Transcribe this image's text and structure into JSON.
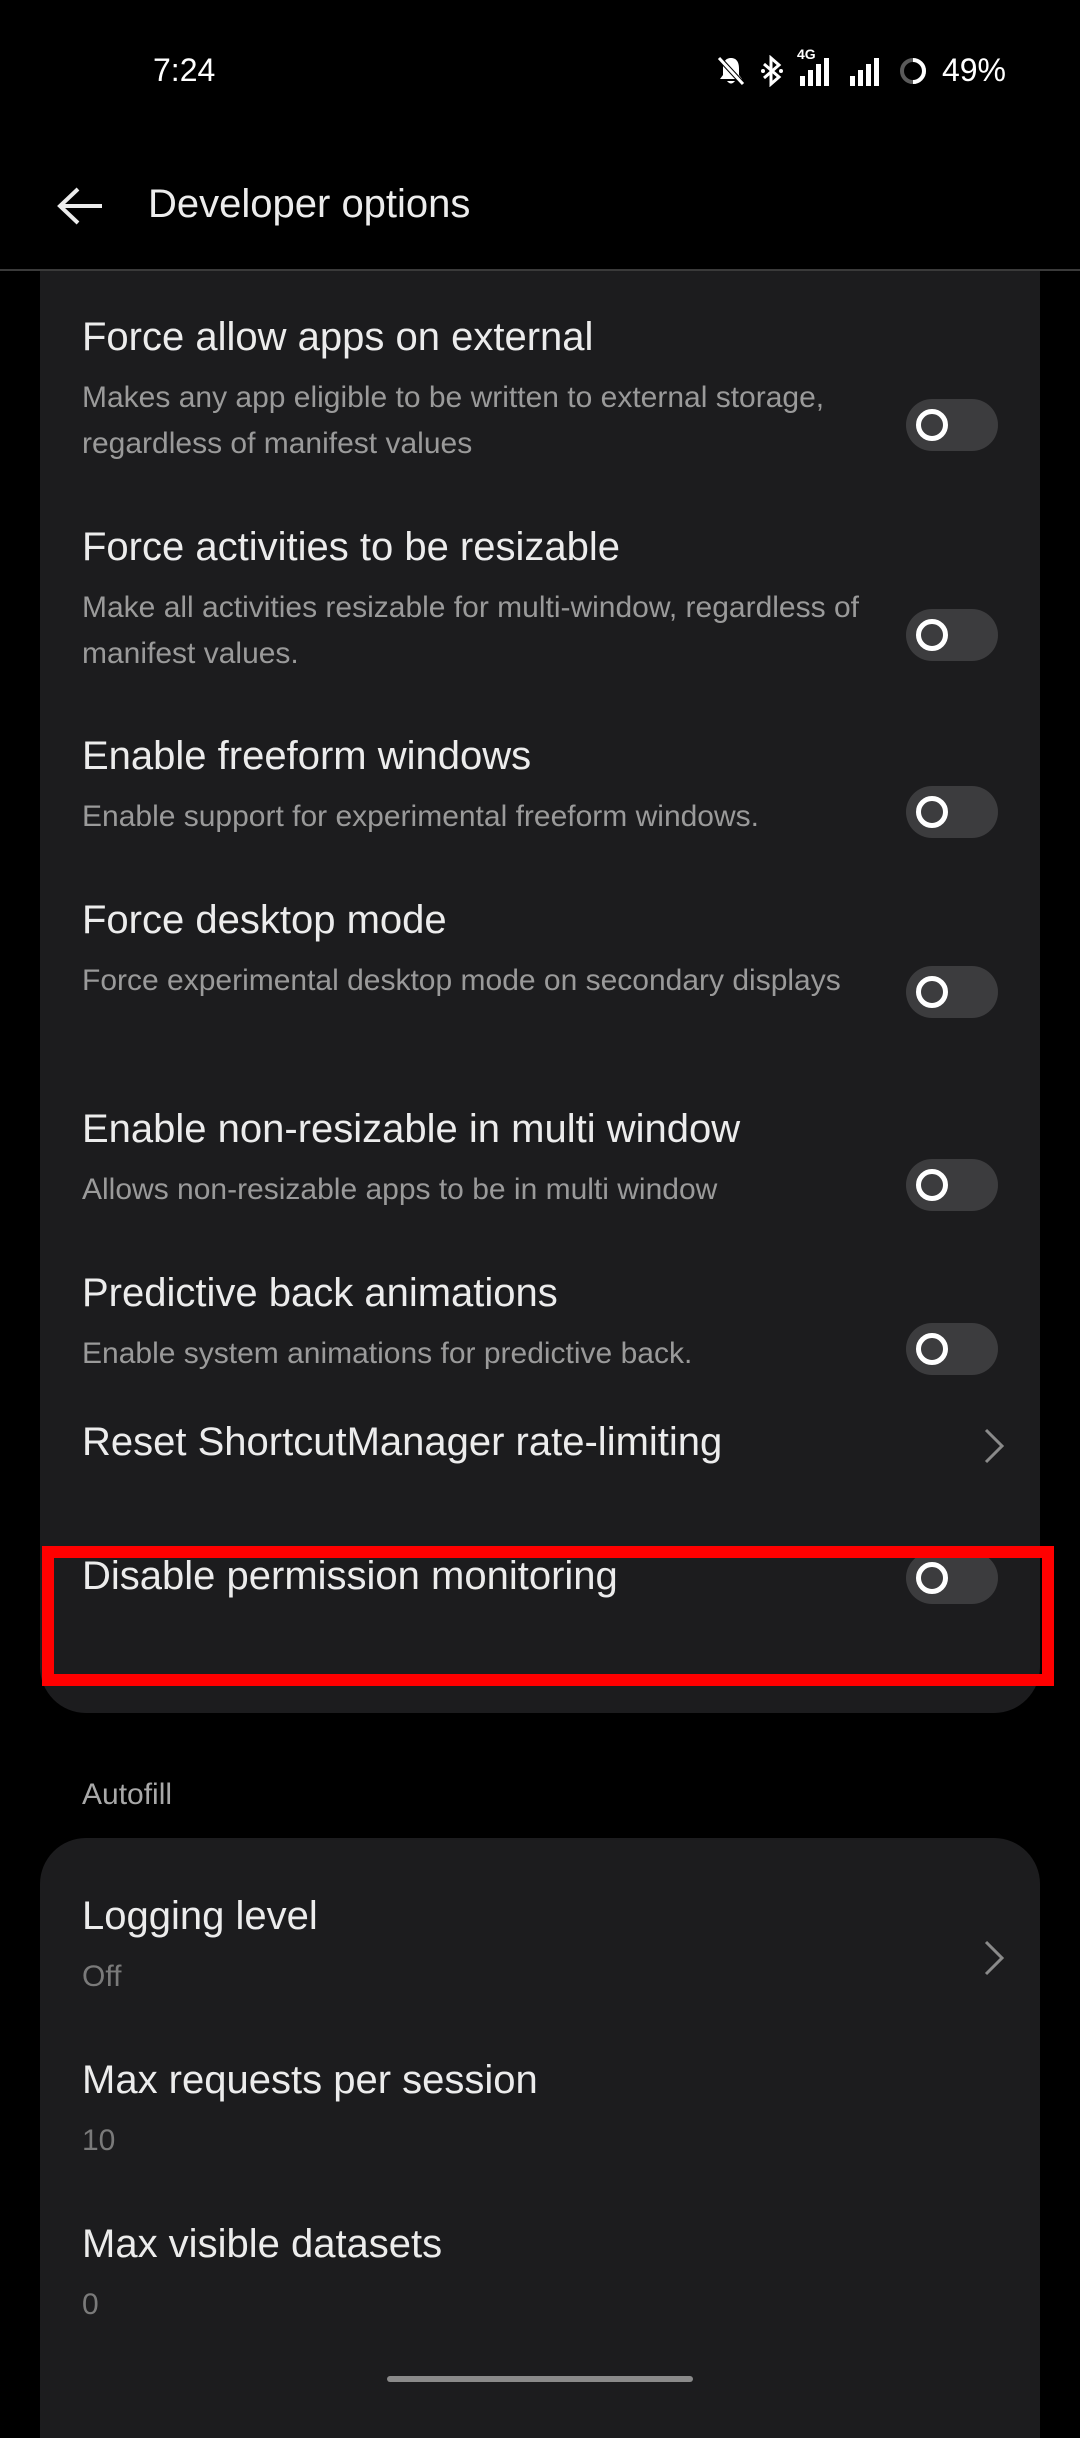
{
  "status_bar": {
    "time": "7:24",
    "network": "4G",
    "battery": "49%"
  },
  "app_bar": {
    "title": "Developer options"
  },
  "settings": [
    {
      "title": "Force allow apps on external",
      "subtitle": "Makes any app eligible to be written to external storage, regardless of manifest values",
      "control": "toggle",
      "enabled": false
    },
    {
      "title": "Force activities to be resizable",
      "subtitle": "Make all activities resizable for multi-window, regardless of manifest values.",
      "control": "toggle",
      "enabled": false
    },
    {
      "title": "Enable freeform windows",
      "subtitle": "Enable support for experimental freeform windows.",
      "control": "toggle",
      "enabled": false
    },
    {
      "title": "Force desktop mode",
      "subtitle": "Force experimental desktop mode on secondary displays",
      "control": "toggle",
      "enabled": false
    },
    {
      "title": "Enable non-resizable in multi window",
      "subtitle": "Allows non-resizable apps to be in multi window",
      "control": "toggle",
      "enabled": false
    },
    {
      "title": "Predictive back animations",
      "subtitle": "Enable system animations for predictive back.",
      "control": "toggle",
      "enabled": false
    },
    {
      "title": "Reset ShortcutManager rate-limiting",
      "control": "chevron"
    },
    {
      "title": "Disable permission monitoring",
      "control": "toggle",
      "enabled": false
    }
  ],
  "autofill": {
    "header": "Autofill",
    "items": [
      {
        "title": "Logging level",
        "value": "Off",
        "control": "chevron"
      },
      {
        "title": "Max requests per session",
        "value": "10"
      },
      {
        "title": "Max visible datasets",
        "value": "0"
      }
    ]
  },
  "colors": {
    "background": "#000000",
    "card": "#1c1c1e",
    "highlight": "#ff0000",
    "toggle_track": "#3c3c3e"
  }
}
